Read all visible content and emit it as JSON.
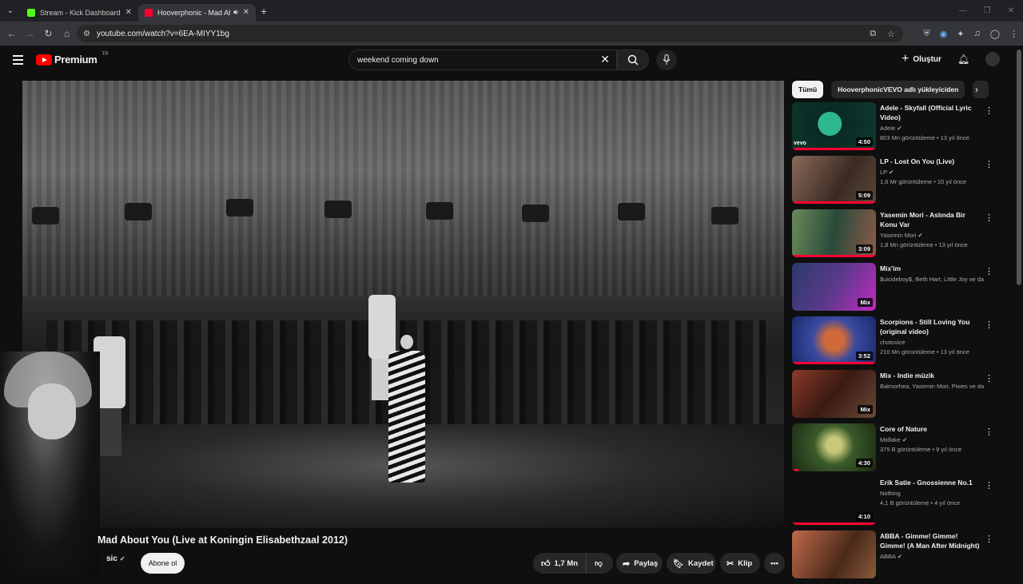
{
  "browser": {
    "tabs": [
      {
        "title": "Stream - Kick Dashboard",
        "favicon_color": "#53fc18",
        "active": false
      },
      {
        "title": "Hooverphonic - Mad About",
        "favicon_color": "#ff0033",
        "active": true
      }
    ],
    "url": "youtube.com/watch?v=6EA-MIYY1bg"
  },
  "header": {
    "logo_word": "Premium",
    "logo_region": "TR",
    "search_query": "weekend coming down",
    "create_label": "Oluştur"
  },
  "video": {
    "title": "Mad About You (Live at Koningin Elisabethzaal 2012)",
    "channel": "sic",
    "subscribe_label": "Abone ol",
    "likes": "1,7 Mn",
    "share_label": "Paylaş",
    "save_label": "Kaydet",
    "clip_label": "Klip"
  },
  "chips": [
    {
      "label": "Tümü",
      "active": true
    },
    {
      "label": "HooverphonicVEVO adlı yükleyiciden",
      "active": false
    }
  ],
  "recommendations": [
    {
      "title": "Adele - Skyfall (Official Lyric Video)",
      "channel": "Adele",
      "verified": true,
      "stats": "803 Mn görüntüleme • 13 yıl önce",
      "duration": "4:50",
      "thumb_color": "#1a8a6a"
    },
    {
      "title": "LP - Lost On You (Live)",
      "channel": "LP",
      "verified": true,
      "stats": "1,6 Mr görüntüleme • 10 yıl önce",
      "duration": "5:09",
      "thumb_color": "#6b4a3a"
    },
    {
      "title": "Yasemin Mori - Aslında Bir Konu Var",
      "channel": "Yasemin Mori",
      "verified": true,
      "stats": "1,8 Mn görüntüleme • 13 yıl önce",
      "duration": "3:09",
      "thumb_color": "#3f6a50"
    },
    {
      "title": "Mix'im",
      "channel": "$uicideboy$, Beth Hart, Little Joy ve dah...",
      "verified": false,
      "stats": "",
      "duration": "Mix",
      "thumb_color": "#5a2a7a"
    },
    {
      "title": "Scorpions - Still Loving You (original video)",
      "channel": "chotovice",
      "verified": false,
      "stats": "210 Mn görüntüleme • 13 yıl önce",
      "duration": "3:52",
      "thumb_color": "#2a4aa0"
    },
    {
      "title": "Mix - Indie müzik",
      "channel": "Balmorhea, Yasemin Mori, Pixies ve dah...",
      "verified": false,
      "stats": "",
      "duration": "Mix",
      "thumb_color": "#6a3a2a"
    },
    {
      "title": "Core of Nature",
      "channel": "Midlake",
      "verified": true,
      "stats": "375 B görüntüleme • 9 yıl önce",
      "duration": "4:30",
      "thumb_color": "#4a5a2a"
    },
    {
      "title": "Erik Satie - Gnossienne No.1",
      "channel": "Nothing",
      "verified": false,
      "stats": "4,1 B görüntüleme • 4 yıl önce",
      "duration": "4:10",
      "thumb_color": "#2a2a2a"
    },
    {
      "title": "ABBA - Gimme! Gimme! Gimme! (A Man After Midnight)",
      "channel": "ABBA",
      "verified": true,
      "stats": "",
      "duration": "",
      "thumb_color": "#9a4a3a"
    }
  ]
}
